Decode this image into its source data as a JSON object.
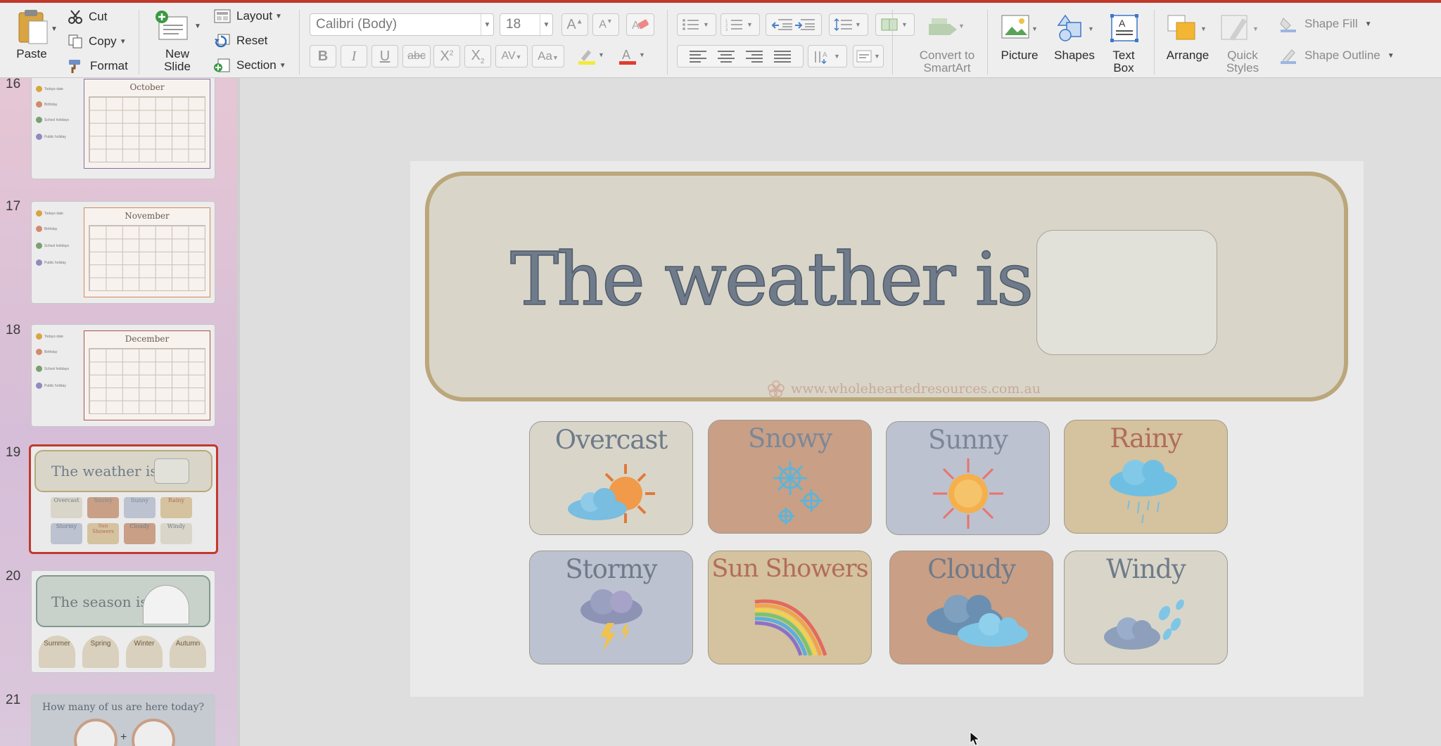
{
  "ribbon": {
    "clipboard": {
      "paste": "Paste",
      "cut": "Cut",
      "copy": "Copy",
      "format": "Format"
    },
    "slides": {
      "new_slide_line1": "New",
      "new_slide_line2": "Slide",
      "layout": "Layout",
      "reset": "Reset",
      "section": "Section"
    },
    "font": {
      "family": "Calibri (Body)",
      "size": "18"
    },
    "insert": {
      "convert_line1": "Convert to",
      "convert_line2": "SmartArt",
      "picture": "Picture",
      "shapes": "Shapes",
      "textbox_line1": "Text",
      "textbox_line2": "Box"
    },
    "drawing": {
      "arrange": "Arrange",
      "quick_styles_line1": "Quick",
      "quick_styles_line2": "Styles",
      "shape_fill": "Shape Fill",
      "shape_outline": "Shape Outline"
    }
  },
  "thumbnails": [
    {
      "number": "16",
      "month": "October",
      "accent": "#8b6fa0"
    },
    {
      "number": "17",
      "month": "November",
      "accent": "#d08b5b"
    },
    {
      "number": "18",
      "month": "December",
      "accent": "#a7534a"
    },
    {
      "number": "19",
      "title": "The weather is",
      "selected": true
    },
    {
      "number": "20",
      "title": "The season is",
      "items": [
        "Summer",
        "Spring",
        "Winter",
        "Autumn"
      ]
    },
    {
      "number": "21",
      "title": "How many of us are here today?"
    }
  ],
  "thumb19_cards": [
    "Overcast",
    "Snowy",
    "Sunny",
    "Rainy",
    "Stormy",
    "Sun Showers",
    "Cloudy",
    "Windy"
  ],
  "slide": {
    "title": "The weather is",
    "website": "www.wholeheartedresources.com.au",
    "cards": [
      {
        "label": "Overcast",
        "bg": "#d9d6c9",
        "color": "#6f7b8a",
        "icon": "overcast-icon"
      },
      {
        "label": "Snowy",
        "bg": "#c99f86",
        "color": "#7b8899",
        "icon": "snowflake-icon"
      },
      {
        "label": "Sunny",
        "bg": "#bcc2cf",
        "color": "#7b8899",
        "icon": "sun-icon"
      },
      {
        "label": "Rainy",
        "bg": "#d5c29e",
        "color": "#b16c5c",
        "icon": "rain-cloud-icon"
      },
      {
        "label": "Stormy",
        "bg": "#bcc2cf",
        "color": "#6f7b8a",
        "icon": "storm-cloud-icon"
      },
      {
        "label": "Sun Showers",
        "bg": "#d5c29e",
        "color": "#b16c5c",
        "icon": "rainbow-icon"
      },
      {
        "label": "Cloudy",
        "bg": "#c99f86",
        "color": "#6f7b8a",
        "icon": "cloud-icon"
      },
      {
        "label": "Windy",
        "bg": "#d9d6c9",
        "color": "#6f7b8a",
        "icon": "wind-icon"
      }
    ]
  },
  "colors": {
    "accent": "#c3392c",
    "header_border": "#bba77c",
    "title_text": "#6f7b8a"
  }
}
